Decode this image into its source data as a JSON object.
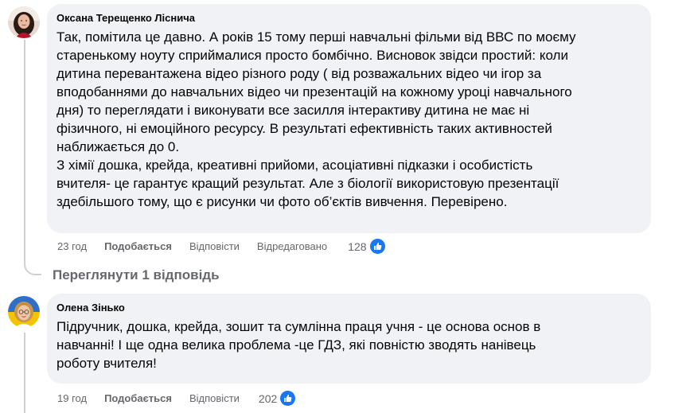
{
  "comments": [
    {
      "author": "Оксана Терещенко Ліснича",
      "text": "Так, помітила це давно. А років 15 тому перші навчальні фільми від ВВС по моєму\nстаренькому ноуту сприймалися просто бомбічно. Висновок звідси простий: коли\nдитина перевантажена відео різного роду ( від розважальних відео чи ігор за\nвподобаннями до навчальних відео чи презентацій на кожному уроці навчального\nдня) то переглядати і виконувати все засилля інтерактиву дитина не має ні\nфізичного, ні емоційного ресурсу. В результаті ефективність таких активностей\nнаближається до 0.\nЗ хімії дошка, крейда, креативні прийоми, асоціативні підказки і особистість\nвчителя- це гарантує кращий результат. Але з біології використовую презентації\nздебільшого тому, що є рисунки чи фото об’єктів вивчення. Перевірено.",
      "time": "23 год",
      "like_label": "Подобається",
      "reply_label": "Відповісти",
      "edited_label": "Відредаговано",
      "reaction_count": "128",
      "reaction_icon": "like-icon",
      "avatar_icon": "profile-avatar"
    },
    {
      "author": "Олена Зінько",
      "text": "Підручник, дошка, крейда, зошит та сумлінна праця учня - це основа основ в\nнавчанні! І ще одна велика проблема -це ГДЗ, які повністю зводять нанівець\nроботу вчителя!",
      "time": "19 год",
      "like_label": "Подобається",
      "reply_label": "Відповісти",
      "reaction_count": "202",
      "reaction_icon": "like-icon",
      "avatar_icon": "profile-avatar"
    }
  ],
  "view_replies_label": "Переглянути 1 відповідь",
  "colors": {
    "bubble_bg": "#f0f2f5",
    "meta_text": "#65676b",
    "like_blue": "#1877f2",
    "thread_line": "#ced0d4"
  }
}
